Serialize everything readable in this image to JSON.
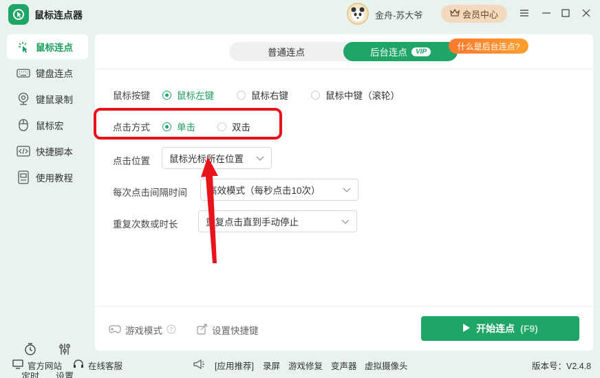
{
  "app": {
    "title": "鼠标连点器",
    "username": "金舟-苏大爷",
    "vip_center": "会员中心"
  },
  "sidebar": {
    "items": [
      {
        "label": "鼠标连点",
        "icon": "click-cursor-icon",
        "active": true
      },
      {
        "label": "键盘连点",
        "icon": "keyboard-icon",
        "active": false
      },
      {
        "label": "键鼠录制",
        "icon": "record-icon",
        "active": false
      },
      {
        "label": "鼠标宏",
        "icon": "mouse-icon",
        "active": false
      },
      {
        "label": "快捷脚本",
        "icon": "script-icon",
        "active": false
      },
      {
        "label": "使用教程",
        "icon": "tutorial-icon",
        "active": false
      }
    ],
    "timer": "定时",
    "settings": "设置"
  },
  "tabs": {
    "normal": "普通连点",
    "background": "后台连点",
    "vip_tag": "VIP",
    "tooltip": "什么是后台连点?"
  },
  "form": {
    "mouse_button": {
      "label": "鼠标按键",
      "options": [
        "鼠标左键",
        "鼠标右键",
        "鼠标中键（滚轮）"
      ],
      "selected": 0
    },
    "click_type": {
      "label": "点击方式",
      "options": [
        "单击",
        "双击"
      ],
      "selected": 0
    },
    "position": {
      "label": "点击位置",
      "value": "鼠标光标所在位置"
    },
    "interval": {
      "label": "每次点击间隔时间",
      "value": "高效模式（每秒点击10次）"
    },
    "repeat": {
      "label": "重复次数或时长",
      "value": "重复点击直到手动停止"
    }
  },
  "footer": {
    "game_mode": "游戏模式",
    "shortcut": "设置快捷键",
    "start": "开始连点",
    "start_key": "(F9)"
  },
  "statusbar": {
    "official_site": "官方网站",
    "online_service": "在线客服",
    "recommend": "[应用推荐]",
    "links": [
      "录屏",
      "游戏修复",
      "变声器",
      "虚拟摄像头"
    ],
    "version": "版本号：V2.4.8"
  },
  "colors": {
    "accent": "#1fa566",
    "highlight": "#e8131b",
    "tooltip": "#ff7a2f"
  }
}
